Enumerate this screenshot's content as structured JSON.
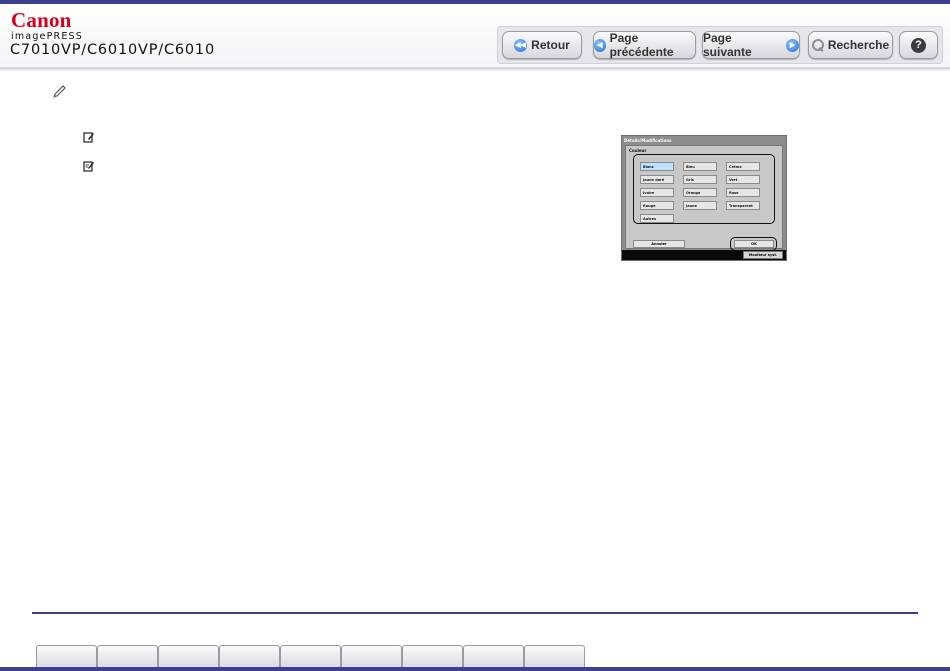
{
  "brand": {
    "logo": "Canon",
    "product": "imagePRESS",
    "models": "C7010VP/C6010VP/C6010"
  },
  "nav": {
    "back_label": "Retour",
    "prev_label": "Page précédente",
    "next_label": "Page suivante",
    "search_label": "Recherche",
    "help_label": "?"
  },
  "screen": {
    "title": "Détails/Modifications",
    "subtitle": "Couleur",
    "buttons": [
      {
        "label": "Blanc",
        "selected": true
      },
      {
        "label": "Bleu",
        "selected": false
      },
      {
        "label": "Crème",
        "selected": false
      },
      {
        "label": "Jaune doré",
        "selected": false
      },
      {
        "label": "Gris",
        "selected": false
      },
      {
        "label": "Vert",
        "selected": false
      },
      {
        "label": "Ivoire",
        "selected": false
      },
      {
        "label": "Orange",
        "selected": false
      },
      {
        "label": "Rose",
        "selected": false
      },
      {
        "label": "Rouge",
        "selected": false
      },
      {
        "label": "Jaune",
        "selected": false
      },
      {
        "label": "Transparent",
        "selected": false
      },
      {
        "label": "Autres",
        "selected": false
      }
    ],
    "cancel_label": "Annuler",
    "ok_label": "OK",
    "status_label": "Moniteur syst."
  },
  "colors": {
    "accent": "#3b3f8f",
    "logo_red": "#d6001c",
    "nav_icon_blue": "#1f6fd6",
    "selected_button": "#bfe0ff"
  },
  "icons": {
    "memo": "pencil-memo-icon",
    "notes": [
      "note-icon",
      "note-edit-icon"
    ]
  },
  "footer_tab_count": 9
}
